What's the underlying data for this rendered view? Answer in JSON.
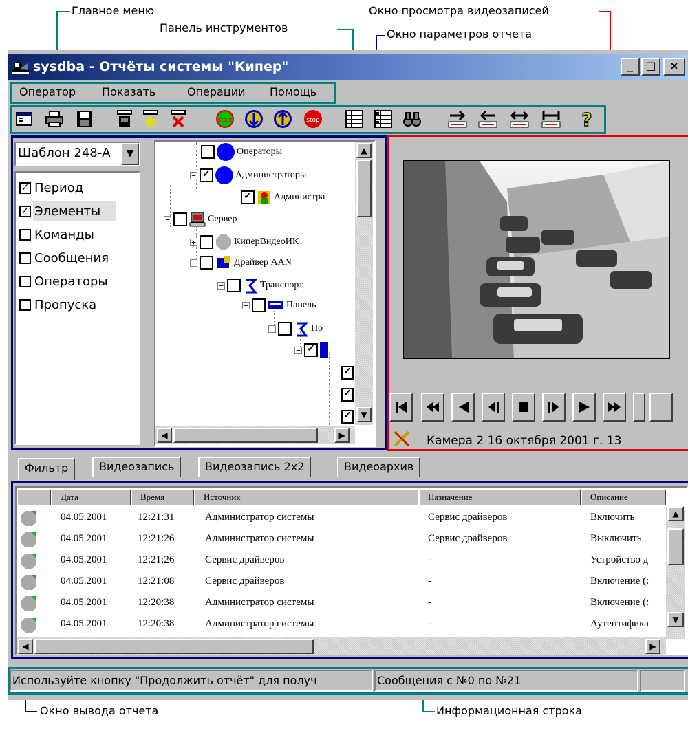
{
  "annotations": {
    "main_menu": "Главное меню",
    "toolbar": "Панель инструментов",
    "report_params": "Окно параметров отчета",
    "video_viewer": "Окно просмотра видеозаписей",
    "report_output": "Окно вывода отчета",
    "info_line": "Информационная строка"
  },
  "colors": {
    "teal": "#008080",
    "red": "#e00000",
    "navy": "#000080"
  },
  "window": {
    "title": "sysdba - Отчёты системы \"Кипер\""
  },
  "menu": [
    "Оператор",
    "Показать",
    "Операции",
    "Помощь"
  ],
  "toolbar_icons": [
    "form-icon",
    "printer-icon",
    "save-icon",
    "report-icon",
    "sun-icon",
    "delete-icon",
    "start-icon",
    "arrow-down-icon",
    "arrow-up-icon",
    "stop-icon",
    "list-icon",
    "checklist-icon",
    "binoculars-icon",
    "step-right-icon",
    "step-left-icon",
    "expand-icon",
    "fit-icon",
    "help-icon"
  ],
  "left_panel": {
    "template": "Шаблон 248-А",
    "checks": [
      {
        "label": "Период",
        "checked": true
      },
      {
        "label": "Элементы",
        "checked": true
      },
      {
        "label": "Команды",
        "checked": false
      },
      {
        "label": "Сообщения",
        "checked": false
      },
      {
        "label": "Операторы",
        "checked": false
      },
      {
        "label": "Пропуска",
        "checked": false
      }
    ]
  },
  "tree": {
    "operators": "Операторы",
    "administrators": "Администраторы",
    "administrator": "Администра",
    "server": "Сервер",
    "kiper_video": "КиперВидеоИК",
    "driver": "Драйвер AAN",
    "transport": "Транспорт",
    "panel": "Панель",
    "po": "По"
  },
  "video": {
    "camera_info": "Камера 2 16 октября 2001 г. 13"
  },
  "tabs": [
    "Фильтр",
    "Видеозапись",
    "Видеозапись 2x2",
    "Видеоархив"
  ],
  "table": {
    "headers": [
      "Дата",
      "Время",
      "Источник",
      "Назначение",
      "Описание"
    ],
    "rows": [
      [
        "04.05.2001",
        "12:21:31",
        "Администратор системы",
        "Сервис драйверов",
        "Включить"
      ],
      [
        "04.05.2001",
        "12:21:26",
        "Администратор системы",
        "Сервис драйверов",
        "Выключить"
      ],
      [
        "04.05.2001",
        "12:21:26",
        "Сервис драйверов",
        "-",
        "Устройство д"
      ],
      [
        "04.05.2001",
        "12:21:08",
        "Сервис драйверов",
        "-",
        "Включение (:"
      ],
      [
        "04.05.2001",
        "12:20:38",
        "Администратор системы",
        "-",
        "Включение (:"
      ],
      [
        "04.05.2001",
        "12:20:38",
        "Администратор системы",
        "-",
        "Аутентифика"
      ]
    ]
  },
  "status": {
    "hint": "Используйте кнопку \"Продолжить отчёт\" для получ",
    "messages": "Сообщения с №0 по  №21"
  }
}
